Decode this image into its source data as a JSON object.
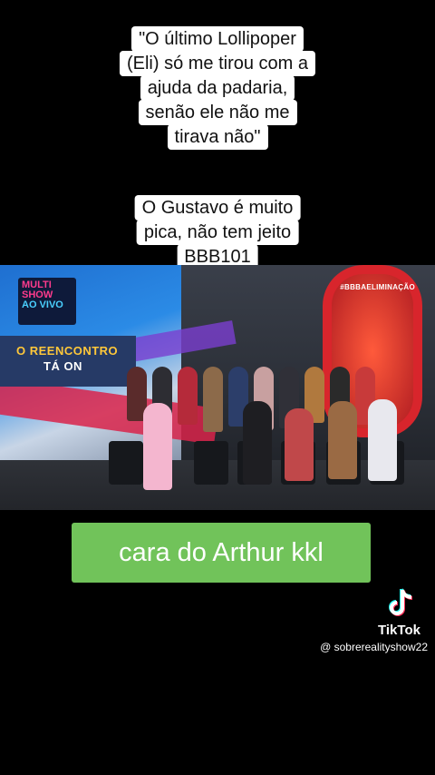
{
  "caption_top": {
    "lines": [
      "\"O último Lollipoper",
      "(Eli) só me tirou com a",
      "ajuda da padaria,",
      "senão ele não me",
      "tirava não\""
    ]
  },
  "caption_mid": {
    "lines": [
      "O Gustavo é muito",
      "pica, não tem jeito",
      "BBB101"
    ]
  },
  "video": {
    "logo_line1": "MULTI",
    "logo_line2": "SHOW",
    "logo_line3": "AO VIVO",
    "banner_line1": "O REENCONTRO",
    "banner_line2": "TÁ ON",
    "hashtag": "#BBBAELIMINAÇÃO"
  },
  "overlay_label": "cara do Arthur kkl",
  "tiktok": {
    "wordmark": "TikTok",
    "handle": "@ sobrerealityshow22",
    "icon": "tiktok-logo-icon"
  },
  "colors": {
    "background": "#000000",
    "caption_bg": "#ffffff",
    "label_bg": "#71c35a"
  }
}
